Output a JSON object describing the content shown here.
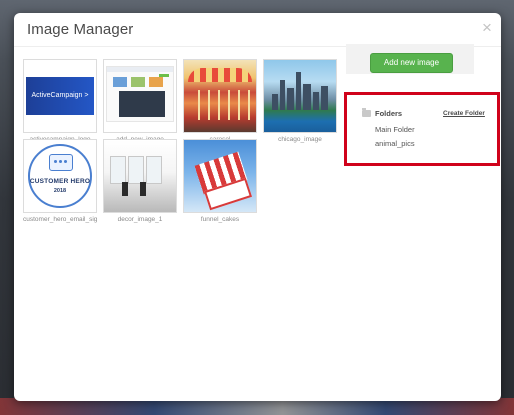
{
  "modal": {
    "title": "Image Manager",
    "close_glyph": "×"
  },
  "images": [
    {
      "name": "activecampaign_logo",
      "thumb_text": "ActiveCampaign >"
    },
    {
      "name": "add_new_image"
    },
    {
      "name": "carosel"
    },
    {
      "name": "chicago_image"
    },
    {
      "name": "customer_hero_email_sig",
      "thumb_text_1": "CUSTOMER HERO",
      "thumb_text_2": "2018"
    },
    {
      "name": "decor_image_1"
    },
    {
      "name": "funnel_cakes"
    }
  ],
  "sidebar": {
    "add_button_label": "Add new image",
    "folders_label": "Folders",
    "create_folder_label": "Create Folder",
    "folders": [
      "Main Folder",
      "animal_pics"
    ]
  },
  "colors": {
    "add_button": "#58b34e",
    "highlight_box": "#d0021b"
  },
  "icons": {
    "close": "close-icon",
    "folder": "folder-icon"
  }
}
